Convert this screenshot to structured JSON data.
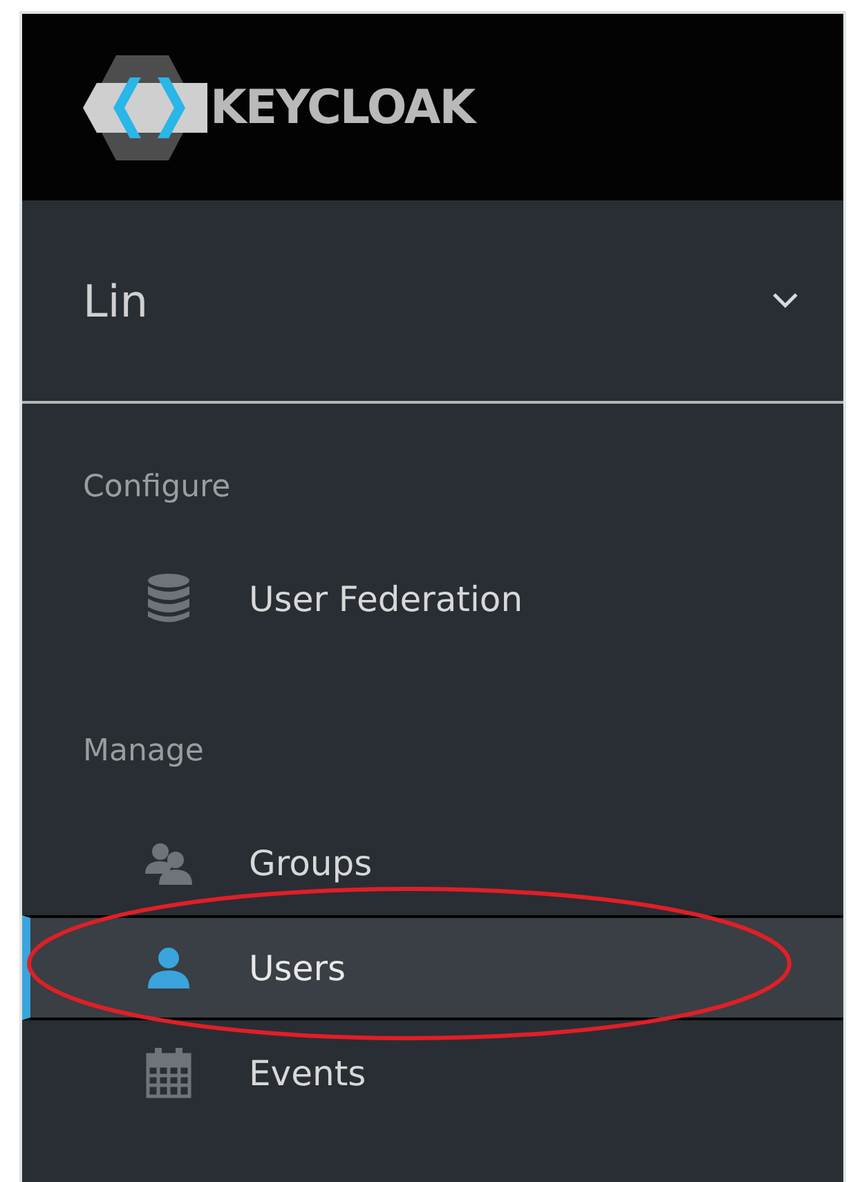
{
  "header": {
    "logo_text": "KEYCLOAK"
  },
  "realm": {
    "name": "Lin"
  },
  "sections": [
    {
      "heading": "Configure",
      "items": [
        {
          "label": "User Federation",
          "kind": "database",
          "selected": false
        }
      ]
    },
    {
      "heading": "Manage",
      "items": [
        {
          "label": "Groups",
          "kind": "group",
          "selected": false
        },
        {
          "label": "Users",
          "kind": "person",
          "selected": true
        },
        {
          "label": "Events",
          "kind": "calendar",
          "selected": false
        }
      ]
    }
  ],
  "annotation": {
    "kind": "ellipse"
  }
}
